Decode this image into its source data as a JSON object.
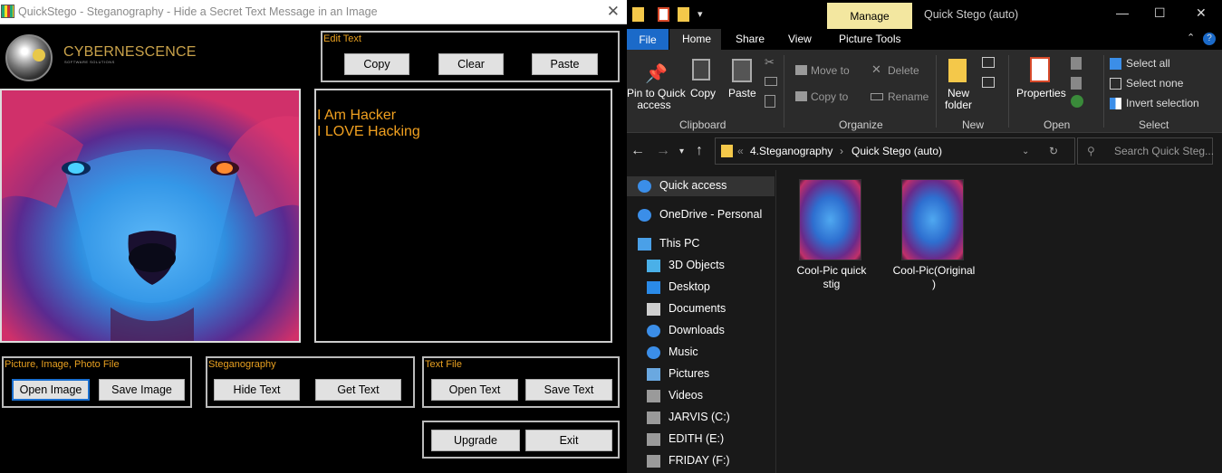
{
  "quickstego": {
    "title": "QuickStego - Steganography - Hide a Secret Text Message in an Image",
    "brand": "CYBERNESCENCE",
    "brand_sub": "SOFTWARE SOLUTIONS",
    "edit_text": {
      "title": "Edit Text",
      "copy": "Copy",
      "clear": "Clear",
      "paste": "Paste"
    },
    "message_lines": [
      "I Am Hacker",
      "I LOVE Hacking"
    ],
    "picture_group": {
      "title": "Picture, Image, Photo File",
      "open": "Open Image",
      "save": "Save Image"
    },
    "stego_group": {
      "title": "Steganography",
      "hide": "Hide Text",
      "get": "Get Text"
    },
    "textfile_group": {
      "title": "Text File",
      "open": "Open Text",
      "save": "Save Text"
    },
    "upgrade": "Upgrade",
    "exit": "Exit"
  },
  "explorer": {
    "manage_tab": "Manage",
    "window_title": "Quick Stego (auto)",
    "tabs": {
      "file": "File",
      "home": "Home",
      "share": "Share",
      "view": "View",
      "picture_tools": "Picture Tools"
    },
    "ribbon": {
      "pin": [
        "Pin to Quick",
        "access"
      ],
      "copy": "Copy",
      "paste": "Paste",
      "clipboard": "Clipboard",
      "move_to": "Move to",
      "copy_to": "Copy to",
      "delete": "Delete",
      "rename": "Rename",
      "organize": "Organize",
      "new_folder": [
        "New",
        "folder"
      ],
      "new": "New",
      "properties": "Properties",
      "open": "Open",
      "select_all": "Select all",
      "select_none": "Select none",
      "invert_selection": "Invert selection",
      "select": "Select"
    },
    "path": {
      "sep": "«",
      "parent": "4.Steganography",
      "current": "Quick Stego (auto)"
    },
    "search_placeholder": "Search Quick Steg...",
    "nav": [
      {
        "label": "Quick access",
        "icon": "star-icon",
        "color": "#3b8ee8"
      },
      {
        "label": "OneDrive - Personal",
        "icon": "cloud-icon",
        "color": "#3b8ee8"
      },
      {
        "label": "This PC",
        "icon": "monitor-icon",
        "color": "#4aa0e8"
      },
      {
        "label": "3D Objects",
        "icon": "cube-icon",
        "color": "#4ab0e8"
      },
      {
        "label": "Desktop",
        "icon": "desktop-icon",
        "color": "#2a8ae8"
      },
      {
        "label": "Documents",
        "icon": "document-icon",
        "color": "#cfcfcf"
      },
      {
        "label": "Downloads",
        "icon": "download-icon",
        "color": "#3b8ee8"
      },
      {
        "label": "Music",
        "icon": "music-icon",
        "color": "#3b8ee8"
      },
      {
        "label": "Pictures",
        "icon": "picture-icon",
        "color": "#6aa8e0"
      },
      {
        "label": "Videos",
        "icon": "video-icon",
        "color": "#9a9a9a"
      },
      {
        "label": "JARVIS (C:)",
        "icon": "drive-icon",
        "color": "#9a9a9a"
      },
      {
        "label": "EDITH (E:)",
        "icon": "drive-icon",
        "color": "#9a9a9a"
      },
      {
        "label": "FRIDAY (F:)",
        "icon": "drive-icon",
        "color": "#9a9a9a"
      }
    ],
    "files": [
      {
        "name_lines": [
          "Cool-Pic quick",
          "stig"
        ]
      },
      {
        "name_lines": [
          "Cool-Pic(Original",
          ")"
        ]
      }
    ]
  }
}
